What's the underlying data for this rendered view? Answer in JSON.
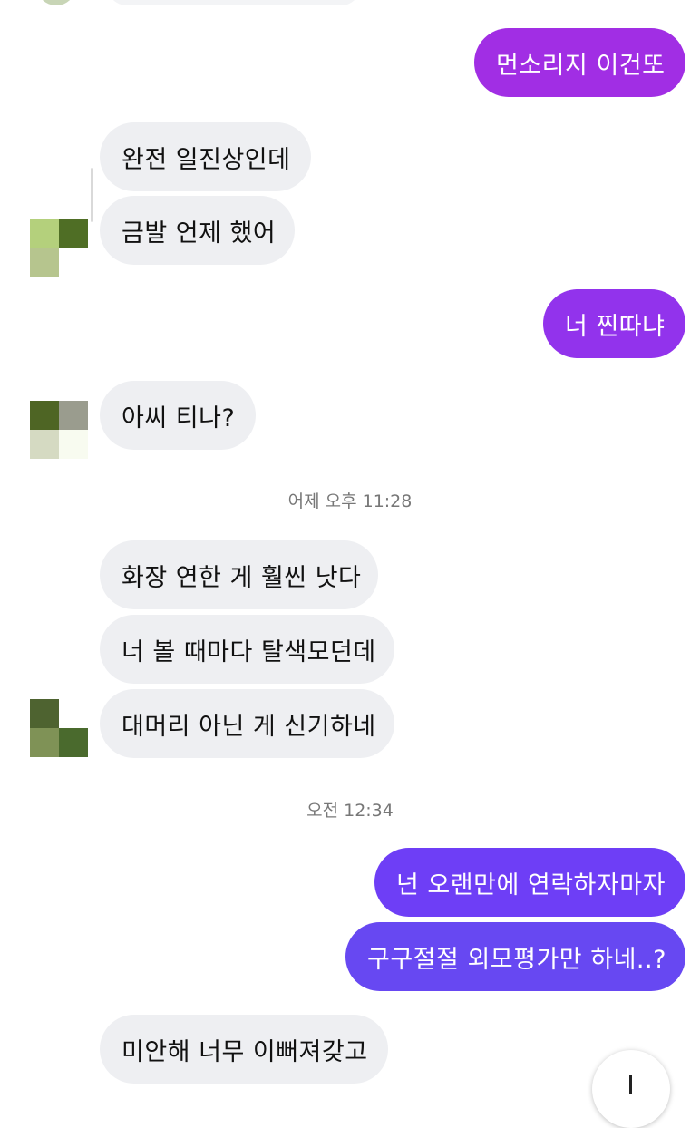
{
  "messages": {
    "m1": "먼소리지 이건또",
    "m2": "완전 일진상인데",
    "m3": "금발 언제 했어",
    "m4": "너 찐따냐",
    "m5": "아씨 티나?",
    "m6": "화장 연한 게 훨씬 낫다",
    "m7": "너 볼 때마다 탈색모던데",
    "m8": "대머리 아닌 게 신기하네",
    "m9": "넌 오랜만에 연락하자마자",
    "m10": "구구절절 외모평가만 하네..?",
    "m11": "미안해 너무 이뻐져갖고"
  },
  "timestamps": {
    "t1": "어제 오후 11:28",
    "t2": "오전 12:34"
  },
  "colors": {
    "sent_purple": "#a22fe6",
    "sent_violet": "#6e3ef5",
    "received_bg": "#eeeff2"
  }
}
